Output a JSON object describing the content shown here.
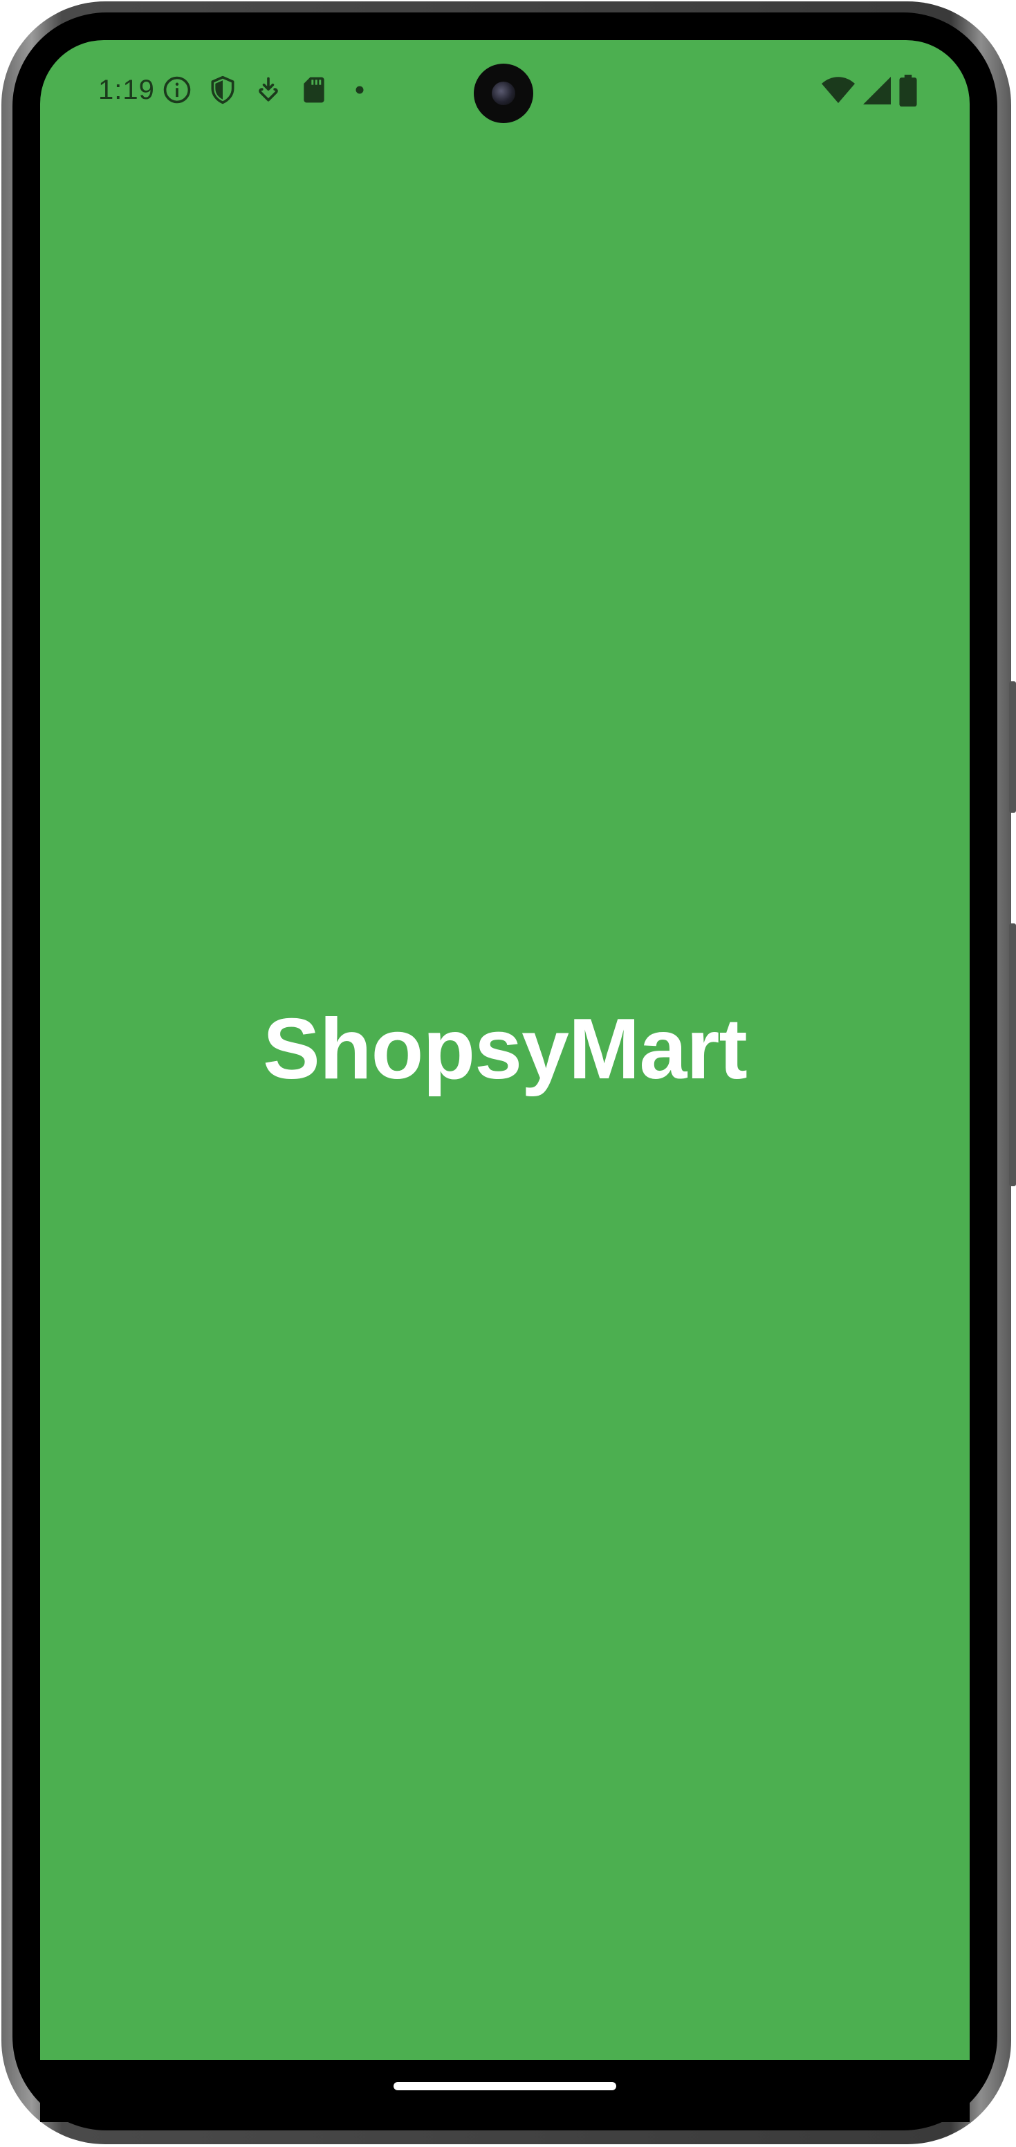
{
  "status_bar": {
    "time": "1:19",
    "left_icons": [
      "info-icon",
      "shield-icon",
      "download-icon",
      "sd-card-icon",
      "dot-icon"
    ],
    "right_icons": [
      "wifi-icon",
      "cellular-signal-icon",
      "battery-icon"
    ]
  },
  "app": {
    "title": "ShopsyMart",
    "background_color": "#4caf50",
    "text_color": "#ffffff"
  }
}
